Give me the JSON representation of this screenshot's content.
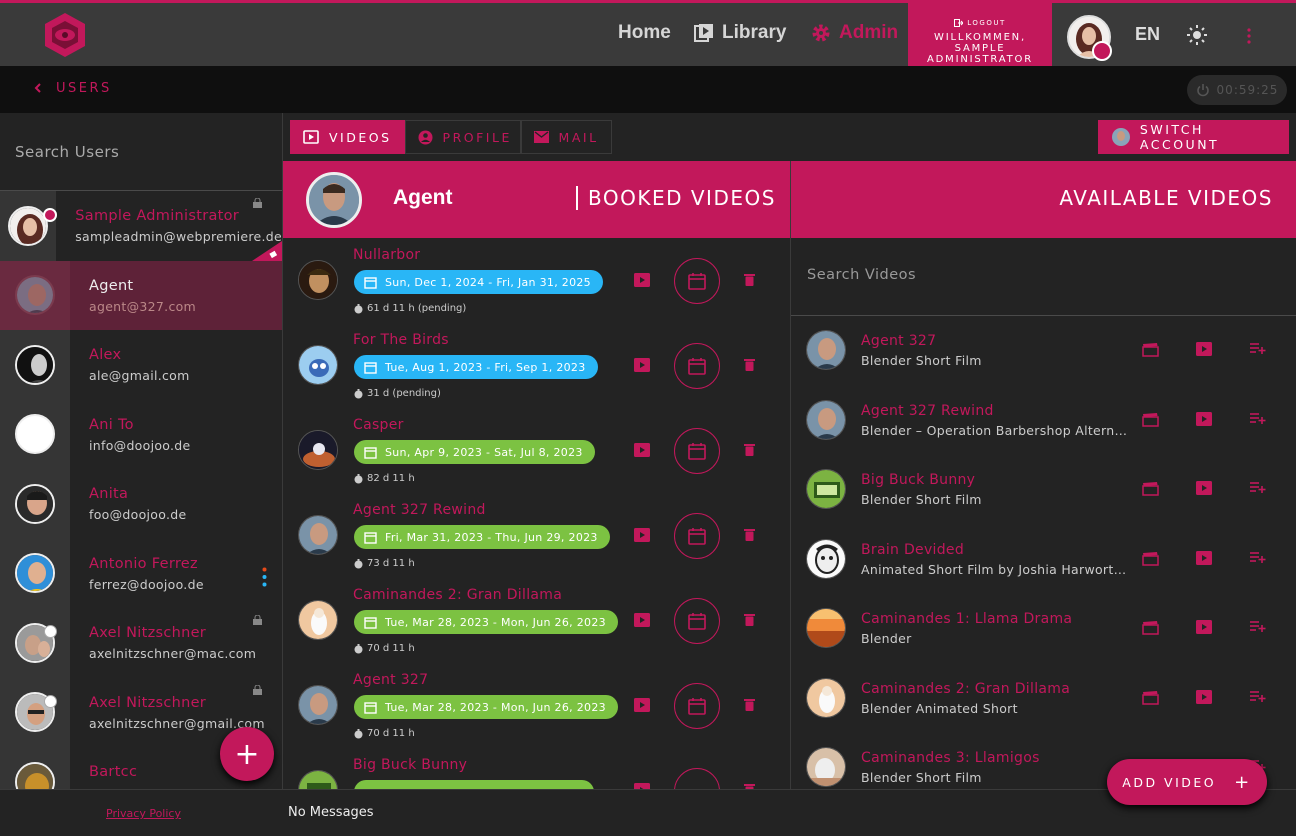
{
  "colors": {
    "accent": "#c2185b",
    "pill_blue": "#29b6f6",
    "pill_green": "#7cc242",
    "bg": "#232323"
  },
  "nav": {
    "home": "Home",
    "library": "Library",
    "admin": "Admin"
  },
  "header": {
    "logout": "LOGOUT",
    "welcome": "WILLKOMMEN, SAMPLE ADMINISTRATOR",
    "lang": "EN"
  },
  "breadcrumb": {
    "label": "USERS"
  },
  "timer": "00:59:25",
  "sidebar": {
    "search_placeholder": "Search Users",
    "users": [
      {
        "name": "Sample Administrator",
        "email": "sampleadmin@webpremiere.de"
      },
      {
        "name": "Agent",
        "email": "agent@327.com"
      },
      {
        "name": "Alex",
        "email": "ale@gmail.com"
      },
      {
        "name": "Ani To",
        "email": "info@doojoo.de"
      },
      {
        "name": "Anita",
        "email": "foo@doojoo.de"
      },
      {
        "name": "Antonio Ferrez",
        "email": "ferrez@doojoo.de"
      },
      {
        "name": "Axel Nitzschner",
        "email": "axelnitzschner@mac.com"
      },
      {
        "name": "Axel Nitzschner",
        "email": "axelnitzschner@gmail.com"
      },
      {
        "name": "Bartcc",
        "email": ""
      }
    ]
  },
  "footer": {
    "privacy": "Privacy Policy",
    "messages": "No Messages"
  },
  "tabs": {
    "videos": "VIDEOS",
    "profile": "PROFILE",
    "mail": "MAIL"
  },
  "switch_account": "SWITCH ACCOUNT",
  "booked": {
    "user": "Agent",
    "title": "BOOKED VIDEOS",
    "items": [
      {
        "title": "Nullarbor",
        "dates": "Sun, Dec 1, 2024 - Fri, Jan 31, 2025",
        "duration": "61 d 11 h (pending)"
      },
      {
        "title": "For The Birds",
        "dates": "Tue, Aug 1, 2023 - Fri, Sep 1, 2023",
        "duration": "31 d (pending)"
      },
      {
        "title": "Casper",
        "dates": "Sun, Apr 9, 2023 - Sat, Jul 8, 2023",
        "duration": "82 d 11 h"
      },
      {
        "title": "Agent 327 Rewind",
        "dates": "Fri, Mar 31, 2023 - Thu, Jun 29, 2023",
        "duration": "73 d 11 h"
      },
      {
        "title": "Caminandes 2: Gran Dillama",
        "dates": "Tue, Mar 28, 2023 - Mon, Jun 26, 2023",
        "duration": "70 d 11 h"
      },
      {
        "title": "Agent 327",
        "dates": "Tue, Mar 28, 2023 - Mon, Jun 26, 2023",
        "duration": "70 d 11 h"
      },
      {
        "title": "Big Buck Bunny",
        "dates": "",
        "duration": ""
      }
    ]
  },
  "available": {
    "title": "AVAILABLE VIDEOS",
    "search_placeholder": "Search Videos",
    "items": [
      {
        "title": "Agent 327",
        "subtitle": "Blender Short Film"
      },
      {
        "title": "Agent 327 Rewind",
        "subtitle": "Blender – Operation Barbershop Alternativ…"
      },
      {
        "title": "Big Buck Bunny",
        "subtitle": "Blender Short Film"
      },
      {
        "title": "Brain Devided",
        "subtitle": "Animated Short Film by Joshia Harworth, J…"
      },
      {
        "title": "Caminandes 1: Llama Drama",
        "subtitle": "Blender"
      },
      {
        "title": "Caminandes 2: Gran Dillama",
        "subtitle": "Blender Animated Short"
      },
      {
        "title": "Caminandes 3: Llamigos",
        "subtitle": "Blender Short Film"
      }
    ]
  },
  "add_video": "ADD VIDEO"
}
